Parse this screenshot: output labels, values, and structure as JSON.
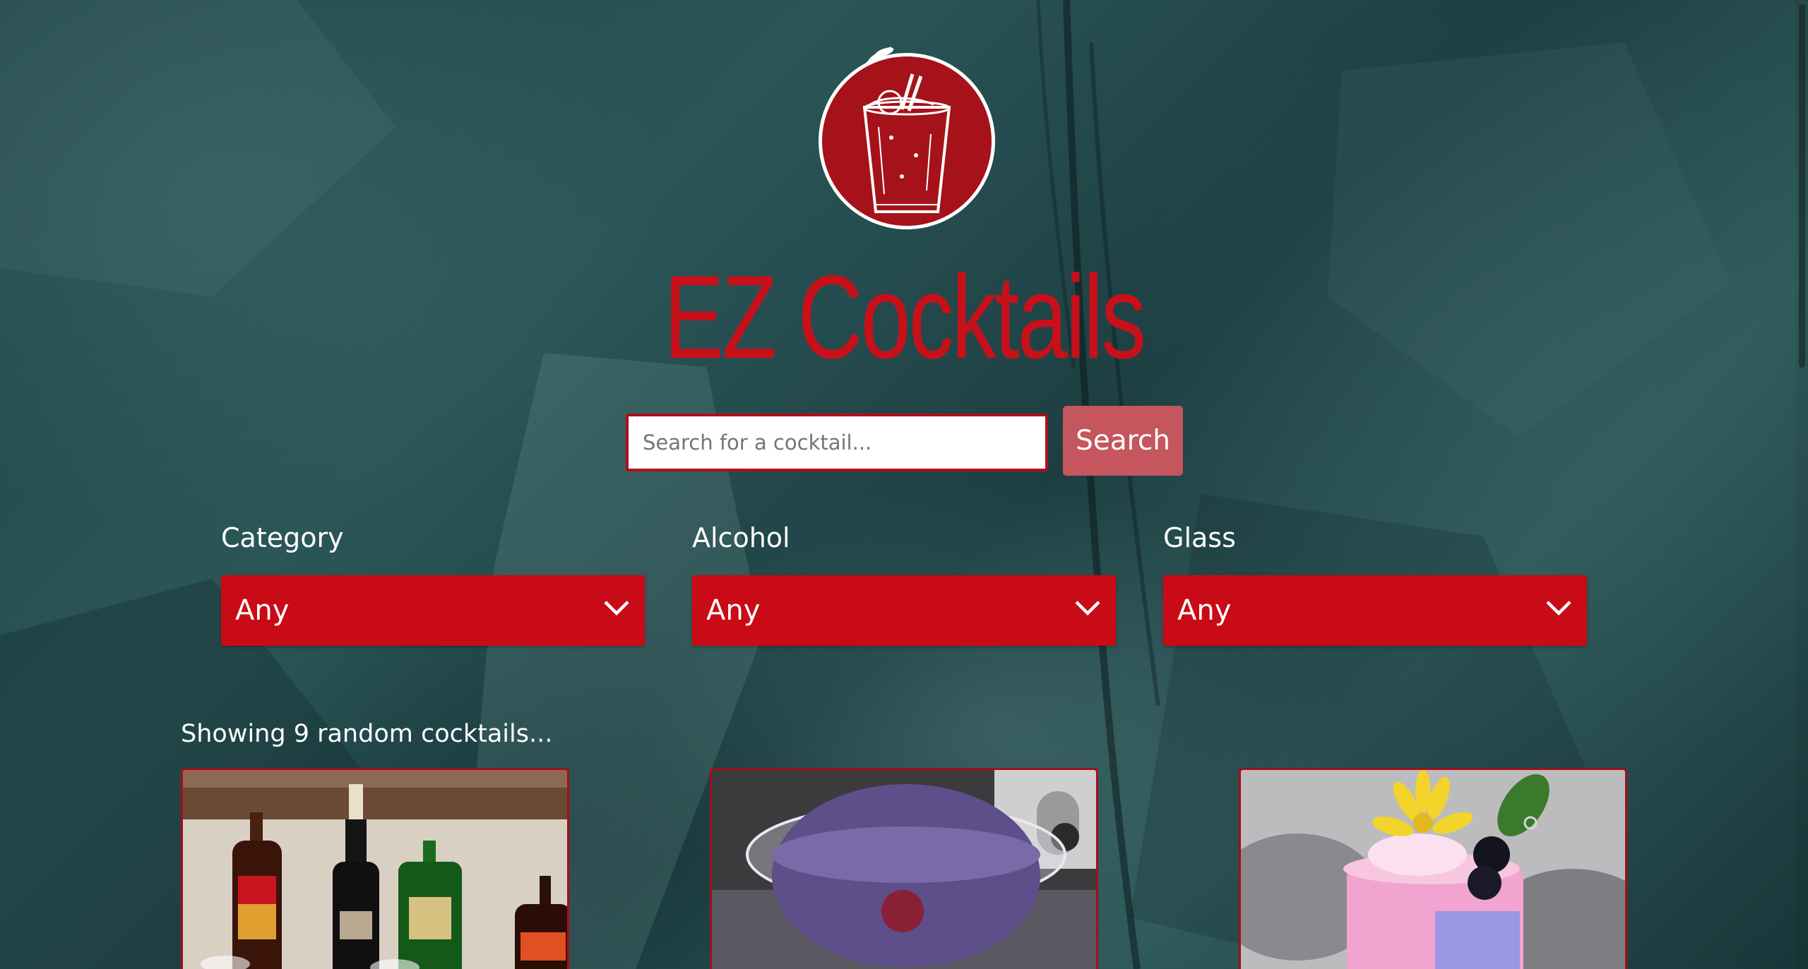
{
  "header": {
    "logo_icon": "cocktail-glass-logo-icon",
    "title": "EZ Cocktails"
  },
  "search": {
    "placeholder": "Search for a cocktail...",
    "value": "",
    "button_label": "Search"
  },
  "filters": [
    {
      "label": "Category",
      "selected": "Any"
    },
    {
      "label": "Alcohol",
      "selected": "Any"
    },
    {
      "label": "Glass",
      "selected": "Any"
    }
  ],
  "results": {
    "status_text": "Showing 9 random cocktails..."
  },
  "colors": {
    "accent": "#c90b17",
    "title": "#c8101b",
    "button": "#c5565d",
    "background": "#2b5658"
  }
}
